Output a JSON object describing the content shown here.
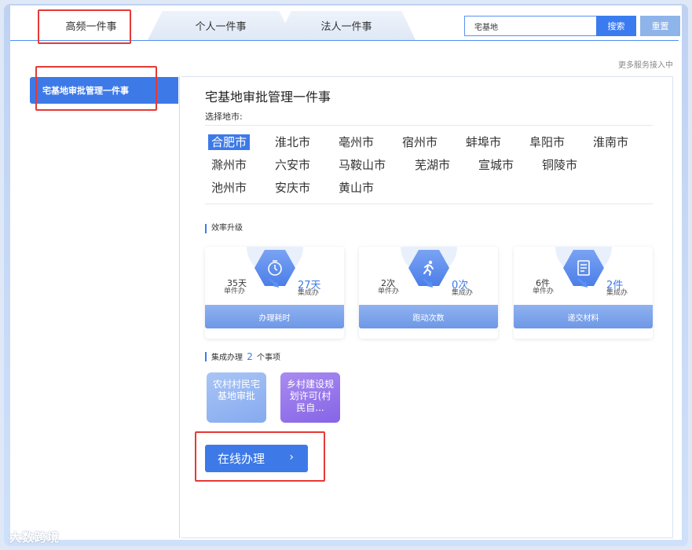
{
  "tabs": [
    {
      "label": "高频一件事",
      "active": true
    },
    {
      "label": "个人一件事",
      "active": false
    },
    {
      "label": "法人一件事",
      "active": false
    }
  ],
  "search": {
    "value": "宅基地",
    "button_label": "搜索",
    "reset_label": "重置"
  },
  "more_services": "更多服务接入中",
  "sidebar": {
    "items": [
      {
        "label": "宅基地审批管理一件事",
        "active": true
      }
    ]
  },
  "main": {
    "title": "宅基地审批管理一件事",
    "select_label": "选择地市:",
    "cities": [
      "合肥市",
      "淮北市",
      "亳州市",
      "宿州市",
      "蚌埠市",
      "阜阳市",
      "淮南市",
      "滁州市",
      "六安市",
      "马鞍山市",
      "芜湖市",
      "宣城市",
      "铜陵市",
      "池州市",
      "安庆市",
      "黄山市"
    ],
    "selected_city": "合肥市",
    "efficiency_title": "效率升级",
    "stats": [
      {
        "icon": "stopwatch-icon",
        "before_value": "35天",
        "before_label": "单件办",
        "after_value": "27天",
        "after_label": "集成办",
        "footer": "办理耗时"
      },
      {
        "icon": "runner-icon",
        "before_value": "2次",
        "before_label": "单件办",
        "after_value": "0次",
        "after_label": "集成办",
        "footer": "跑动次数"
      },
      {
        "icon": "document-icon",
        "before_value": "6件",
        "before_label": "单件办",
        "after_value": "2件",
        "after_label": "集成办",
        "footer": "递交材料"
      }
    ],
    "integrated": {
      "prefix": "集成办理",
      "count": "2",
      "suffix": "个事项"
    },
    "items": [
      {
        "label": "农村村民宅基地审批"
      },
      {
        "label": "乡村建设规划许可(村民自..."
      }
    ],
    "online_button": "在线办理",
    "online_chevron": "›"
  },
  "watermark": "大数跨境",
  "colors": {
    "accent": "#3d7ae8",
    "highlight_box": "#e53935",
    "purple_card": "#8664e6"
  }
}
